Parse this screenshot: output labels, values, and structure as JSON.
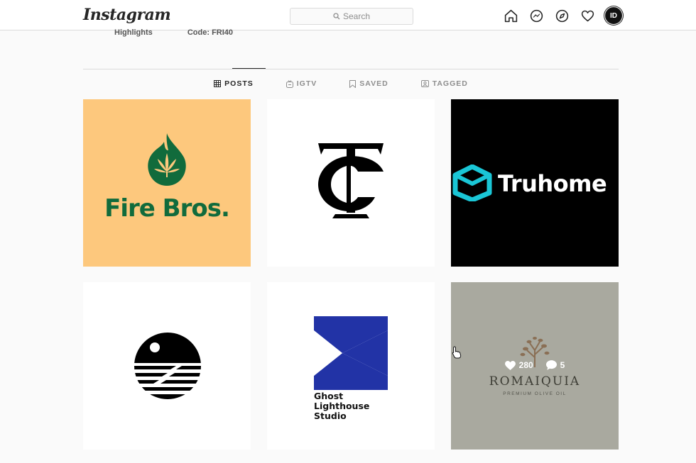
{
  "app": {
    "logo": "Instagram"
  },
  "search": {
    "placeholder": "Search"
  },
  "profile_strip": {
    "highlights": "Highlights",
    "code": "Code: FRI40"
  },
  "tabs": [
    {
      "label": "POSTS",
      "icon": "grid-icon",
      "active": true
    },
    {
      "label": "IGTV",
      "icon": "igtv-icon",
      "active": false
    },
    {
      "label": "SAVED",
      "icon": "bookmark-icon",
      "active": false
    },
    {
      "label": "TAGGED",
      "icon": "tagged-icon",
      "active": false
    }
  ],
  "nav": {
    "avatar_initials": "ID"
  },
  "posts": [
    {
      "brand": "Fire Bros.",
      "bg": "#fdc87d",
      "accent": "#116b3c"
    },
    {
      "brand": "",
      "bg": "#ffffff",
      "accent": "#000000"
    },
    {
      "brand": "Truhome",
      "bg": "#000000",
      "accent": "#1ac6d6"
    },
    {
      "brand": "",
      "bg": "#ffffff",
      "accent": "#000000"
    },
    {
      "brand_lines": [
        "Ghost",
        "Lighthouse",
        "Studio"
      ],
      "bg": "#ffffff",
      "accent": "#2233a6"
    },
    {
      "brand": "ROMAIQUIA",
      "tagline": "PREMIUM OLIVE OIL",
      "bg": "#a9a99f",
      "likes": "280",
      "comments": "5"
    }
  ]
}
